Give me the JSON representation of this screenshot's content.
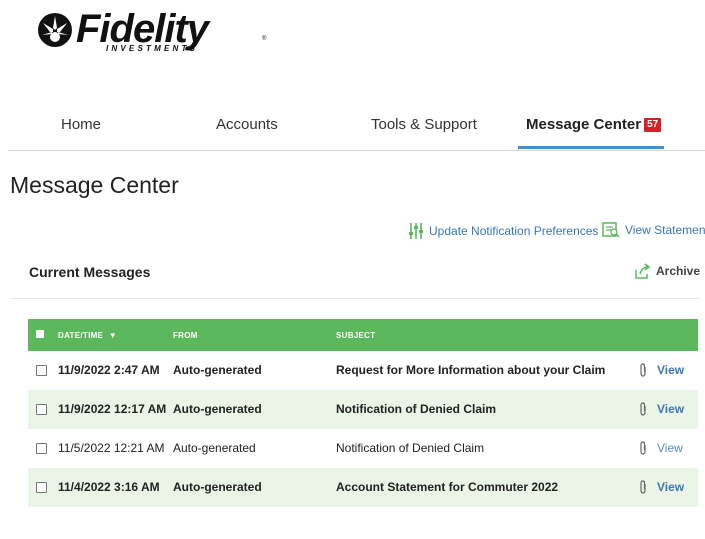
{
  "logo": {
    "brand": "Fidelity",
    "sub": "INVESTMENTS",
    "reg": "®"
  },
  "nav": {
    "items": [
      {
        "label": "Home"
      },
      {
        "label": "Accounts"
      },
      {
        "label": "Tools & Support"
      },
      {
        "label": "Message Center",
        "badge": "57"
      }
    ]
  },
  "page": {
    "title": "Message Center"
  },
  "actions": {
    "update_prefs": "Update Notification Preferences",
    "view_statements": "View Statements"
  },
  "section": {
    "title": "Current Messages",
    "archive": "Archive"
  },
  "table": {
    "headers": {
      "date": "DATE/TIME",
      "sort_arrow": "▼",
      "from": "FROM",
      "subject": "SUBJECT"
    },
    "rows": [
      {
        "date": "11/9/2022 2:47 AM",
        "from": "Auto-generated",
        "subject": "Request for More Information about your Claim",
        "action": "View",
        "unread": true
      },
      {
        "date": "11/9/2022 12:17 AM",
        "from": "Auto-generated",
        "subject": "Notification of Denied Claim",
        "action": "View",
        "unread": true
      },
      {
        "date": "11/5/2022 12:21 AM",
        "from": "Auto-generated",
        "subject": "Notification of Denied Claim",
        "action": "View",
        "unread": false
      },
      {
        "date": "11/4/2022 3:16 AM",
        "from": "Auto-generated",
        "subject": "Account Statement for Commuter 2022",
        "action": "View",
        "unread": true
      }
    ]
  },
  "colors": {
    "header_green": "#5cb85c",
    "row_alt": "#eaf5e7",
    "link_blue": "#3a77b8",
    "badge_red": "#d61f26",
    "tab_underline": "#3f8fd2"
  }
}
